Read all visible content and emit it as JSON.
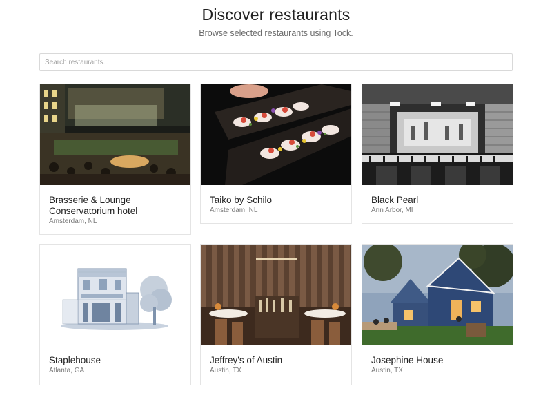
{
  "header": {
    "title": "Discover restaurants",
    "subtitle": "Browse selected restaurants using Tock."
  },
  "search": {
    "placeholder": "Search restaurants...",
    "value": ""
  },
  "restaurants": [
    {
      "name_line1": "Brasserie & Lounge",
      "name_line2": "Conservatorium hotel",
      "location": "Amsterdam, NL",
      "image": "hotel-lounge-photo"
    },
    {
      "name_line1": "Taiko by Schilo",
      "name_line2": "",
      "location": "Amsterdam, NL",
      "image": "sushi-plates-photo"
    },
    {
      "name_line1": "Black Pearl",
      "name_line2": "",
      "location": "Ann Arbor, MI",
      "image": "bar-interior-photo"
    },
    {
      "name_line1": "Staplehouse",
      "name_line2": "",
      "location": "Atlanta, GA",
      "image": "building-sketch-illustration"
    },
    {
      "name_line1": "Jeffrey's of Austin",
      "name_line2": "",
      "location": "Austin, TX",
      "image": "dining-room-photo"
    },
    {
      "name_line1": "Josephine House",
      "name_line2": "",
      "location": "Austin, TX",
      "image": "blue-house-photo"
    }
  ]
}
